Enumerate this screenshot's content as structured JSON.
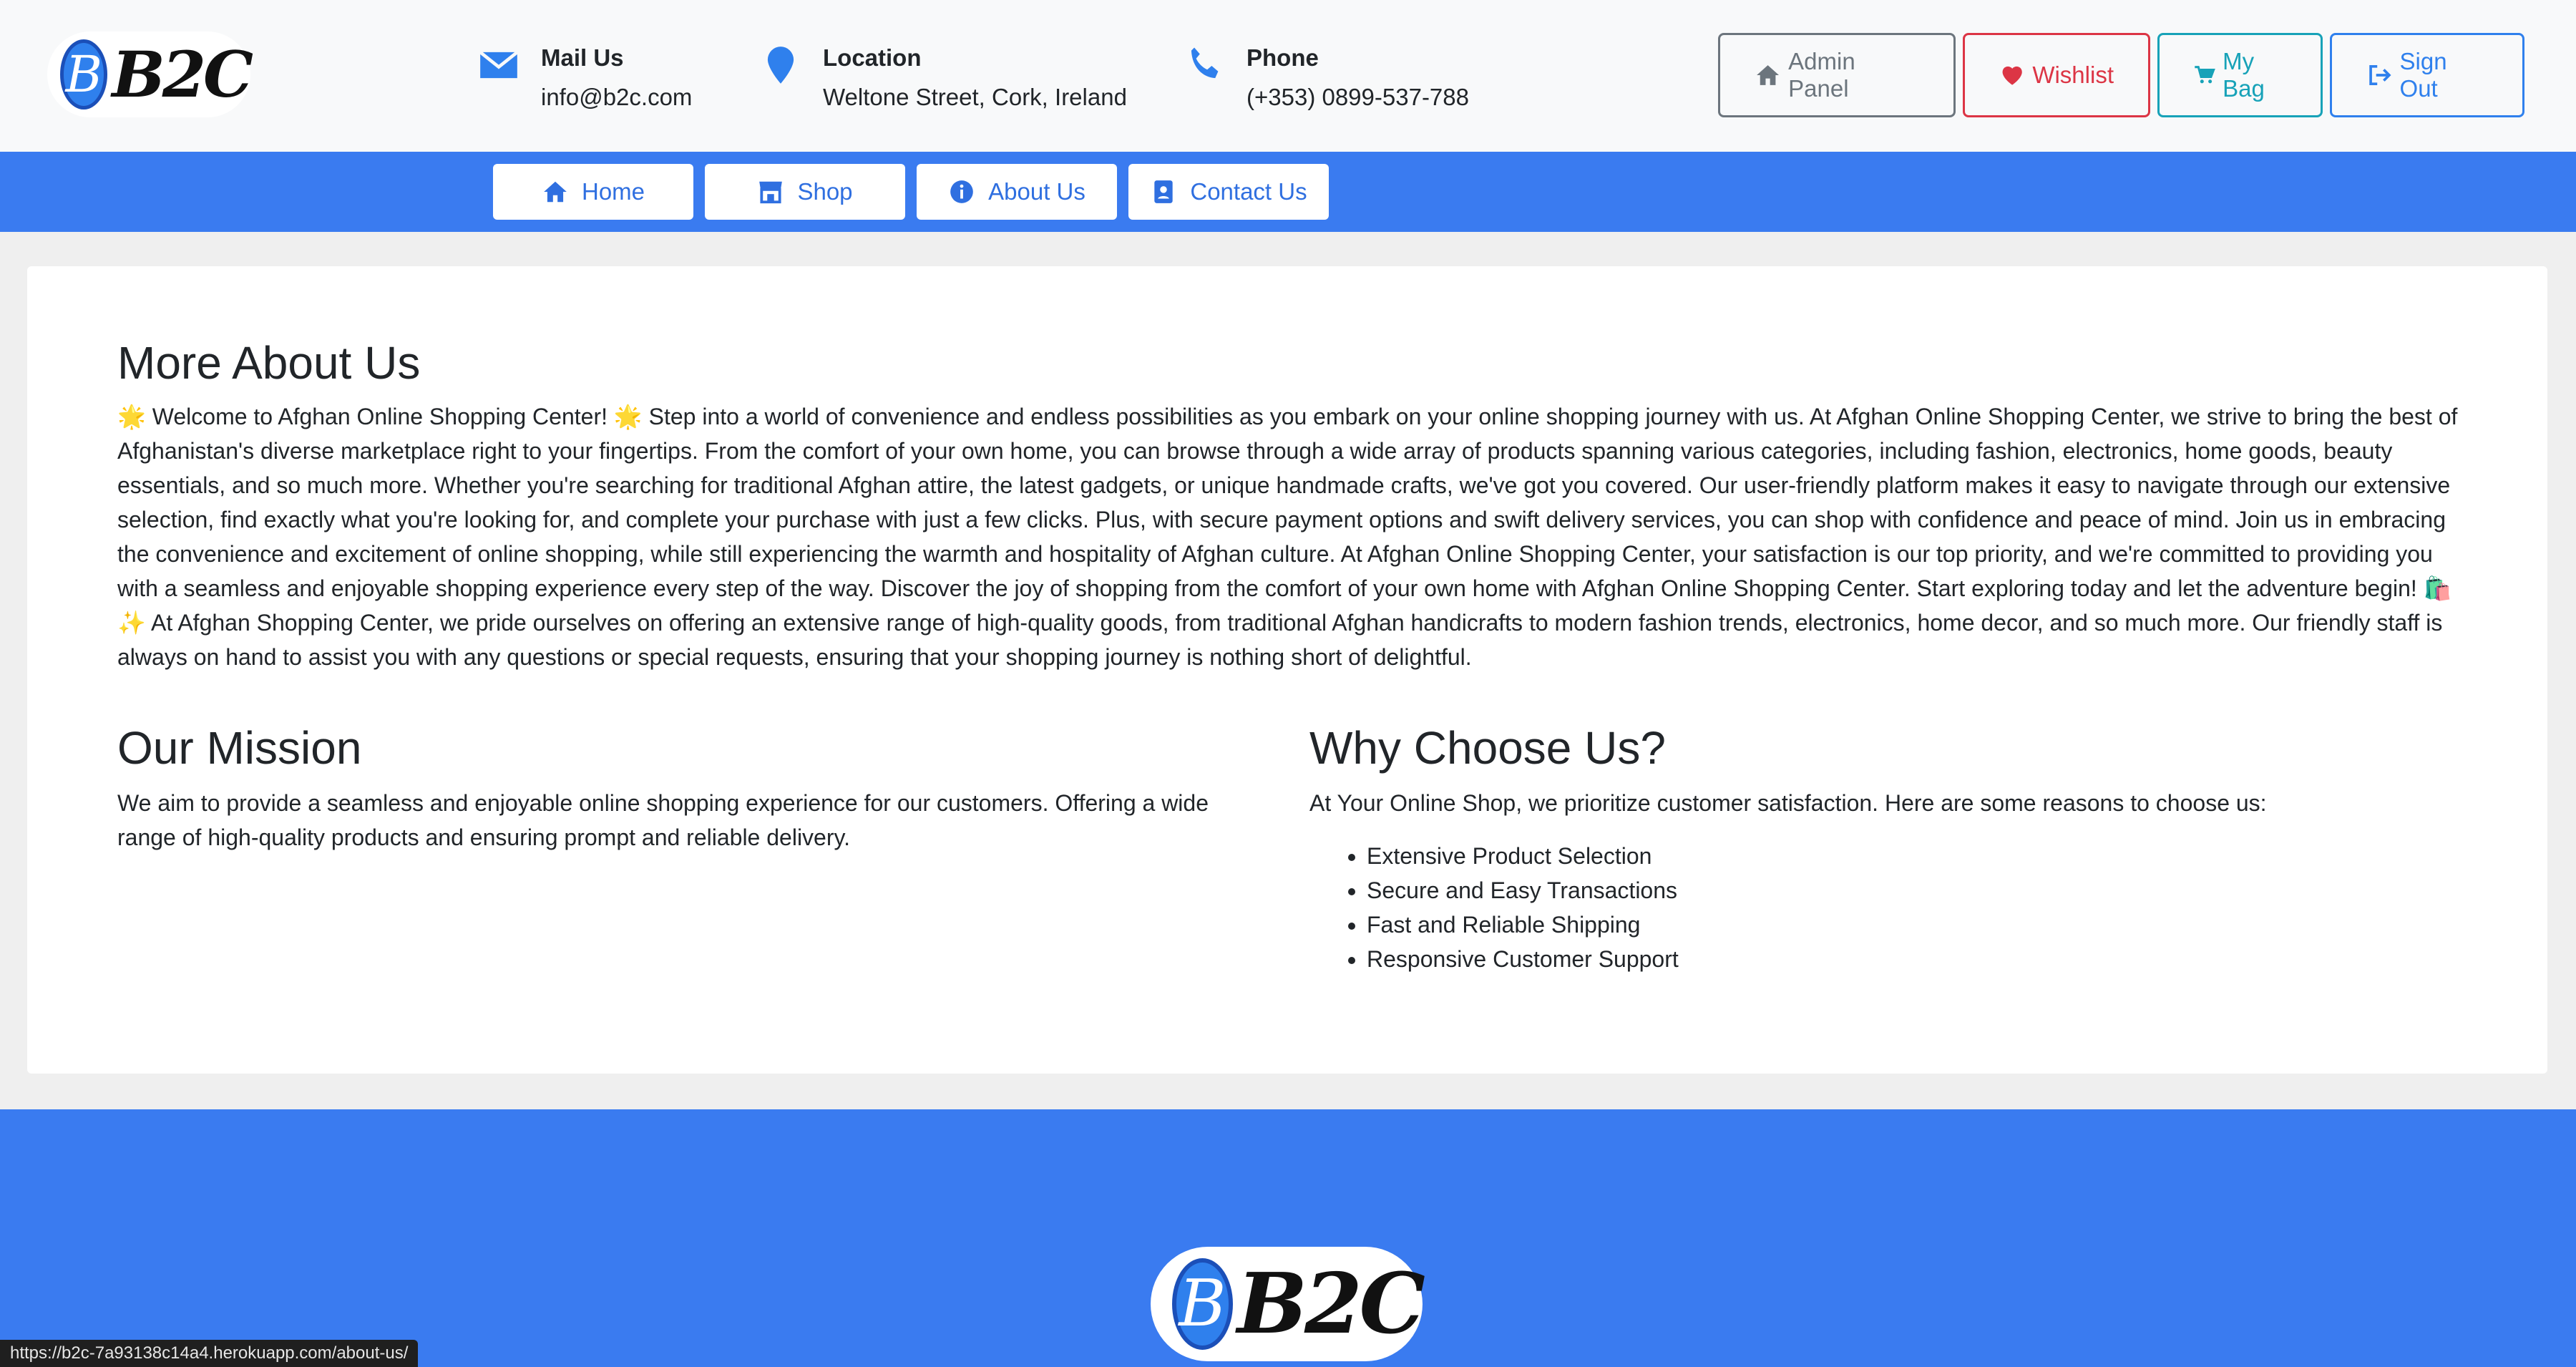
{
  "brand": {
    "logo_text": "B2C",
    "logo_letter": "B"
  },
  "contacts": [
    {
      "icon": "mail-icon",
      "title": "Mail Us",
      "value": "info@b2c.com"
    },
    {
      "icon": "location-pin-icon",
      "title": "Location",
      "value": "Weltone Street, Cork, Ireland"
    },
    {
      "icon": "phone-icon",
      "title": "Phone",
      "value": "(+353) 0899-537-788"
    }
  ],
  "actions": {
    "admin": "Admin Panel",
    "wishlist": "Wishlist",
    "bag": "My Bag",
    "signout": "Sign Out"
  },
  "nav": {
    "home": "Home",
    "shop": "Shop",
    "about": "About Us",
    "contact": "Contact Us"
  },
  "about": {
    "title": "More About Us",
    "body": "🌟 Welcome to Afghan Online Shopping Center! 🌟 Step into a world of convenience and endless possibilities as you embark on your online shopping journey with us. At Afghan Online Shopping Center, we strive to bring the best of Afghanistan's diverse marketplace right to your fingertips. From the comfort of your own home, you can browse through a wide array of products spanning various categories, including fashion, electronics, home goods, beauty essentials, and so much more. Whether you're searching for traditional Afghan attire, the latest gadgets, or unique handmade crafts, we've got you covered. Our user-friendly platform makes it easy to navigate through our extensive selection, find exactly what you're looking for, and complete your purchase with just a few clicks. Plus, with secure payment options and swift delivery services, you can shop with confidence and peace of mind. Join us in embracing the convenience and excitement of online shopping, while still experiencing the warmth and hospitality of Afghan culture. At Afghan Online Shopping Center, your satisfaction is our top priority, and we're committed to providing you with a seamless and enjoyable shopping experience every step of the way. Discover the joy of shopping from the comfort of your own home with Afghan Online Shopping Center. Start exploring today and let the adventure begin! 🛍️✨ At Afghan Shopping Center, we pride ourselves on offering an extensive range of high-quality goods, from traditional Afghan handicrafts to modern fashion trends, electronics, home decor, and so much more. Our friendly staff is always on hand to assist you with any questions or special requests, ensuring that your shopping journey is nothing short of delightful."
  },
  "mission": {
    "title": "Our Mission",
    "body": "We aim to provide a seamless and enjoyable online shopping experience for our customers. Offering a wide range of high-quality products and ensuring prompt and reliable delivery."
  },
  "why": {
    "title": "Why Choose Us?",
    "intro": "At Your Online Shop, we prioritize customer satisfaction. Here are some reasons to choose us:",
    "items": [
      "Extensive Product Selection",
      "Secure and Easy Transactions",
      "Fast and Reliable Shipping",
      "Responsive Customer Support"
    ]
  },
  "status_url": "https://b2c-7a93138c14a4.herokuapp.com/about-us/",
  "colors": {
    "primary": "#3a7bf0",
    "danger": "#dc3545",
    "info": "#17a2b8",
    "secondary": "#6c757d"
  }
}
